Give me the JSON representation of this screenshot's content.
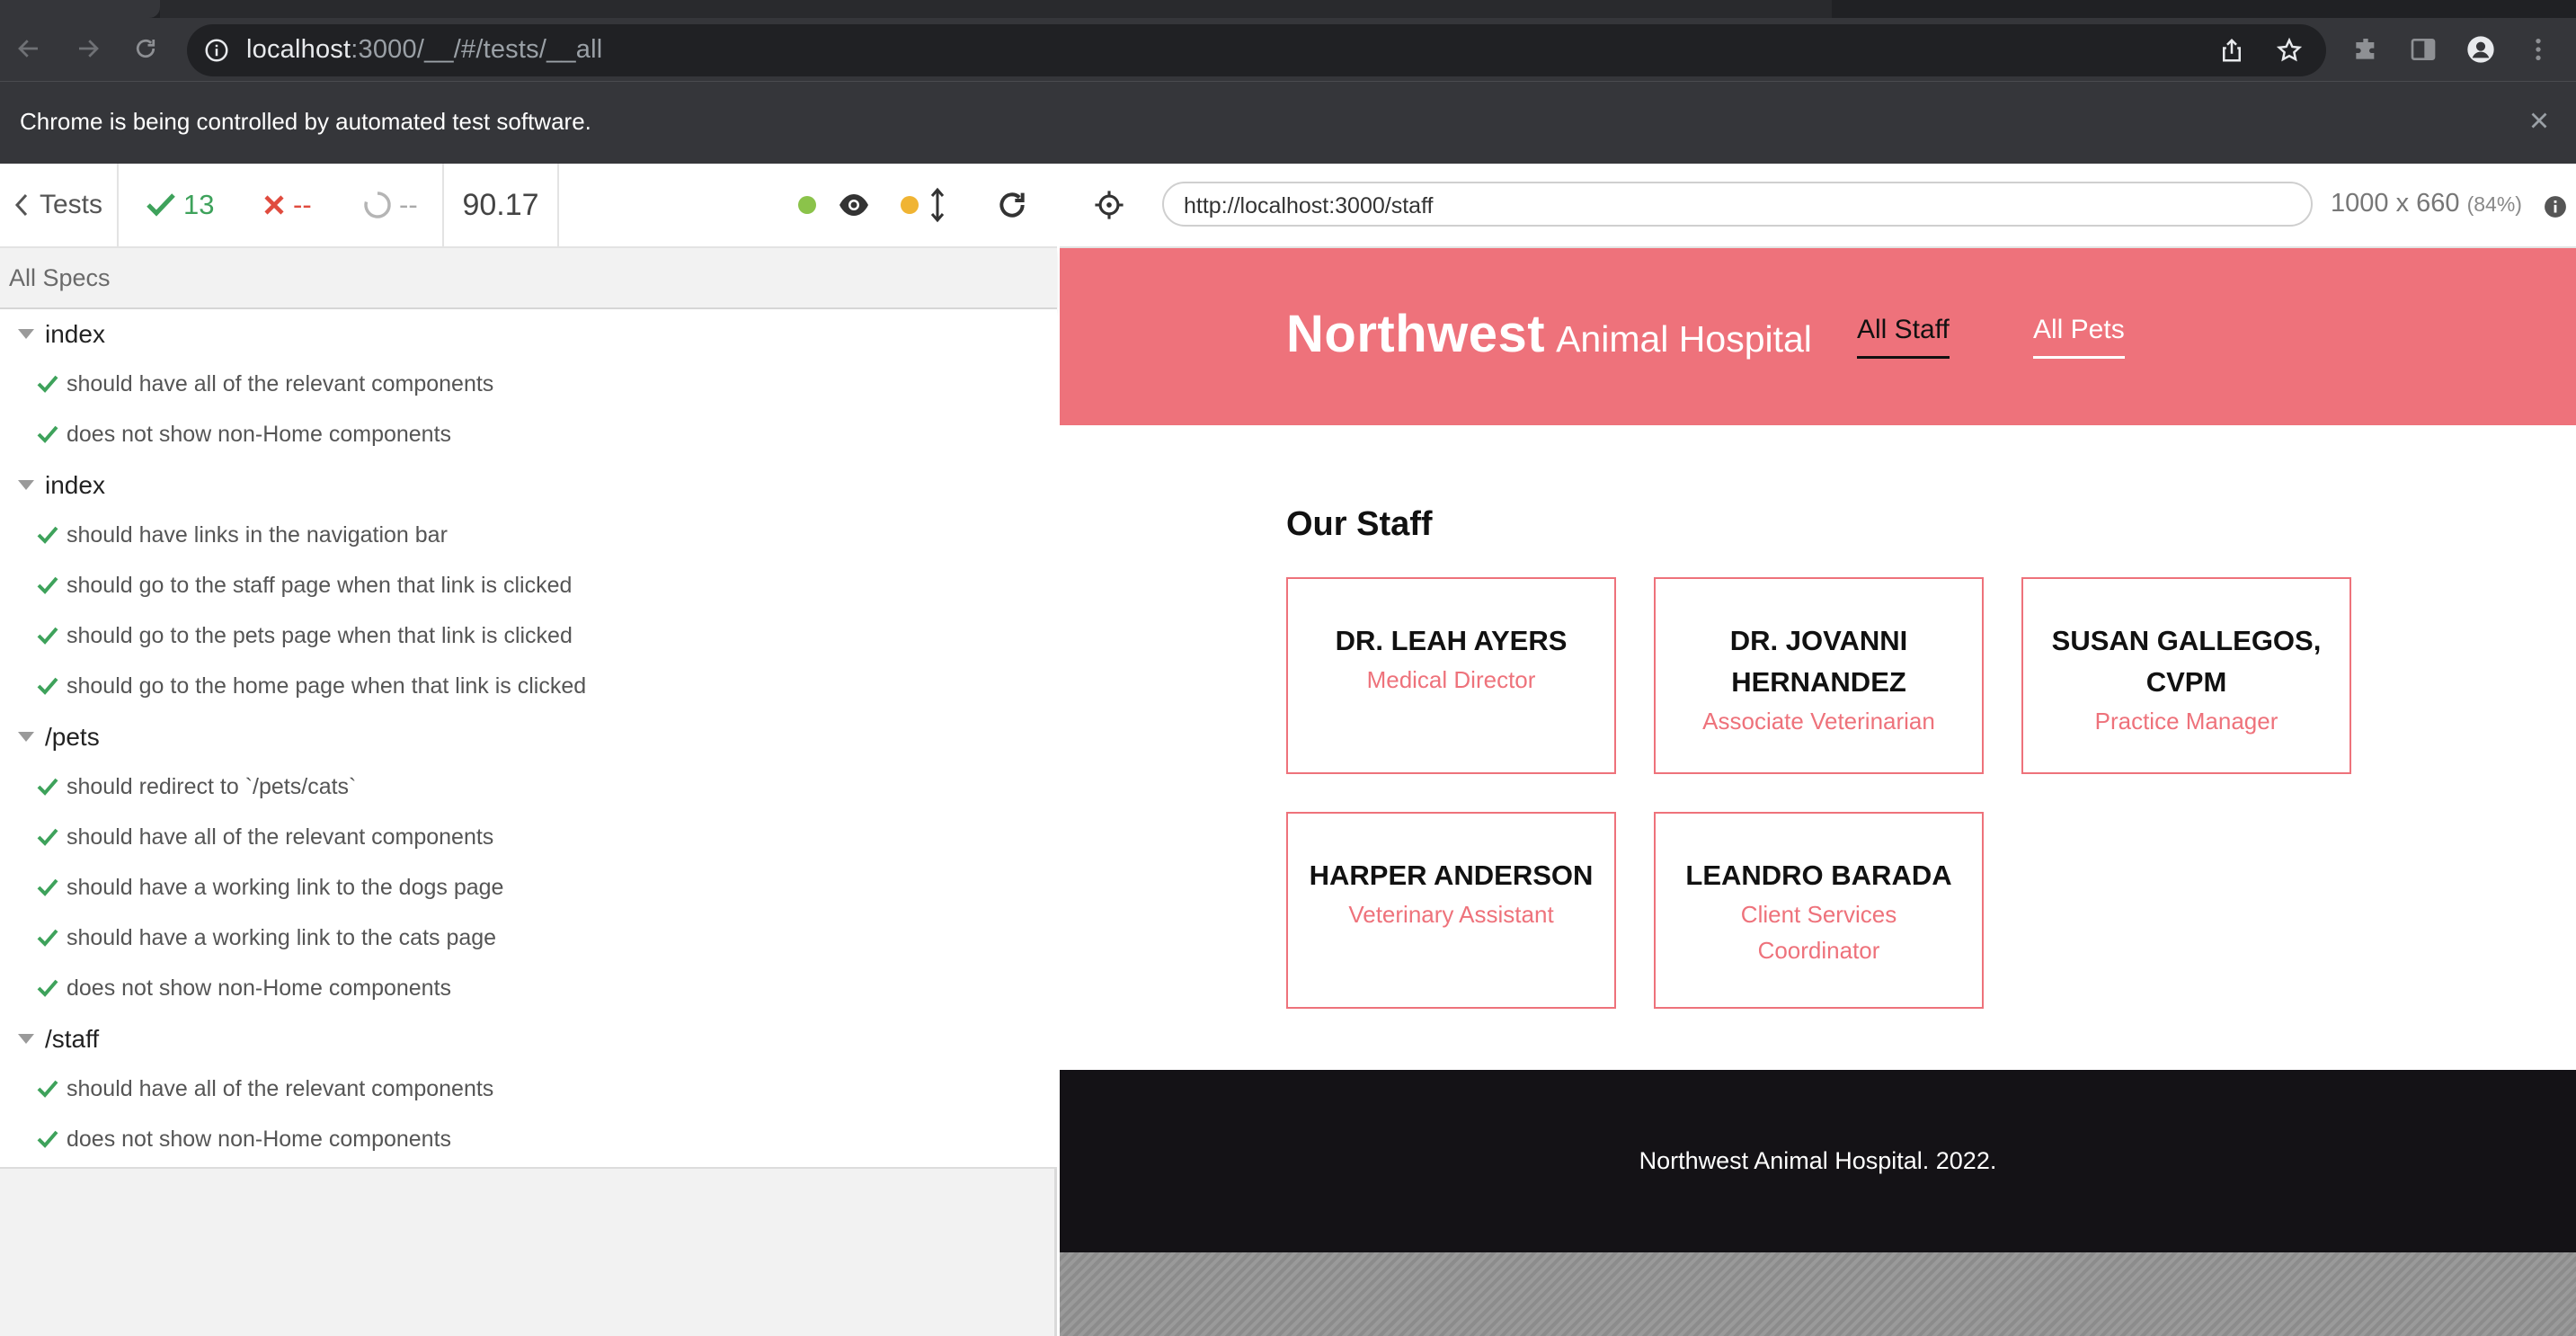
{
  "browser": {
    "url_host": "localhost",
    "url_rest": ":3000/__/#/tests/__all",
    "automation_message": "Chrome is being controlled by automated test software."
  },
  "reporter": {
    "tests_label": "Tests",
    "passed": "13",
    "failed": "--",
    "pending": "--",
    "duration": "90.17",
    "all_specs": "All Specs",
    "suites": [
      {
        "title": "index",
        "tests": [
          "should have all of the relevant components",
          "does not show non-Home components"
        ]
      },
      {
        "title": "index",
        "tests": [
          "should have links in the navigation bar",
          "should go to the staff page when that link is clicked",
          "should go to the pets page when that link is clicked",
          "should go to the home page when that link is clicked"
        ]
      },
      {
        "title": "/pets",
        "tests": [
          "should redirect to `/pets/cats`",
          "should have all of the relevant components",
          "should have a working link to the dogs page",
          "should have a working link to the cats page",
          "does not show non-Home components"
        ]
      },
      {
        "title": "/staff",
        "tests": [
          "should have all of the relevant components",
          "does not show non-Home components"
        ]
      }
    ],
    "colors": {
      "pass": "#3ea25b",
      "fail": "#e04b3e",
      "pending_dot": "#f0b433",
      "running_dot": "#8bc34a"
    }
  },
  "aut": {
    "url": "http://localhost:3000/staff",
    "size": "1000 x 660",
    "scale": "(84%)"
  },
  "site": {
    "brand_bold": "Northwest",
    "brand_light": "Animal Hospital",
    "nav": {
      "staff": "All Staff",
      "pets": "All Pets"
    },
    "heading": "Our Staff",
    "staff": [
      {
        "name": "DR. LEAH AYERS",
        "role": "Medical Director"
      },
      {
        "name": "DR. JOVANNI HERNANDEZ",
        "role": "Associate Veterinarian"
      },
      {
        "name": "SUSAN GALLEGOS, CVPM",
        "role": "Practice Manager"
      },
      {
        "name": "HARPER ANDERSON",
        "role": "Veterinary Assistant"
      },
      {
        "name": "LEANDRO BARADA",
        "role": "Client Services Coordinator"
      }
    ],
    "footer": "Northwest Animal Hospital. 2022.",
    "colors": {
      "brand": "#ee727b",
      "footer_bg": "#141216"
    }
  }
}
